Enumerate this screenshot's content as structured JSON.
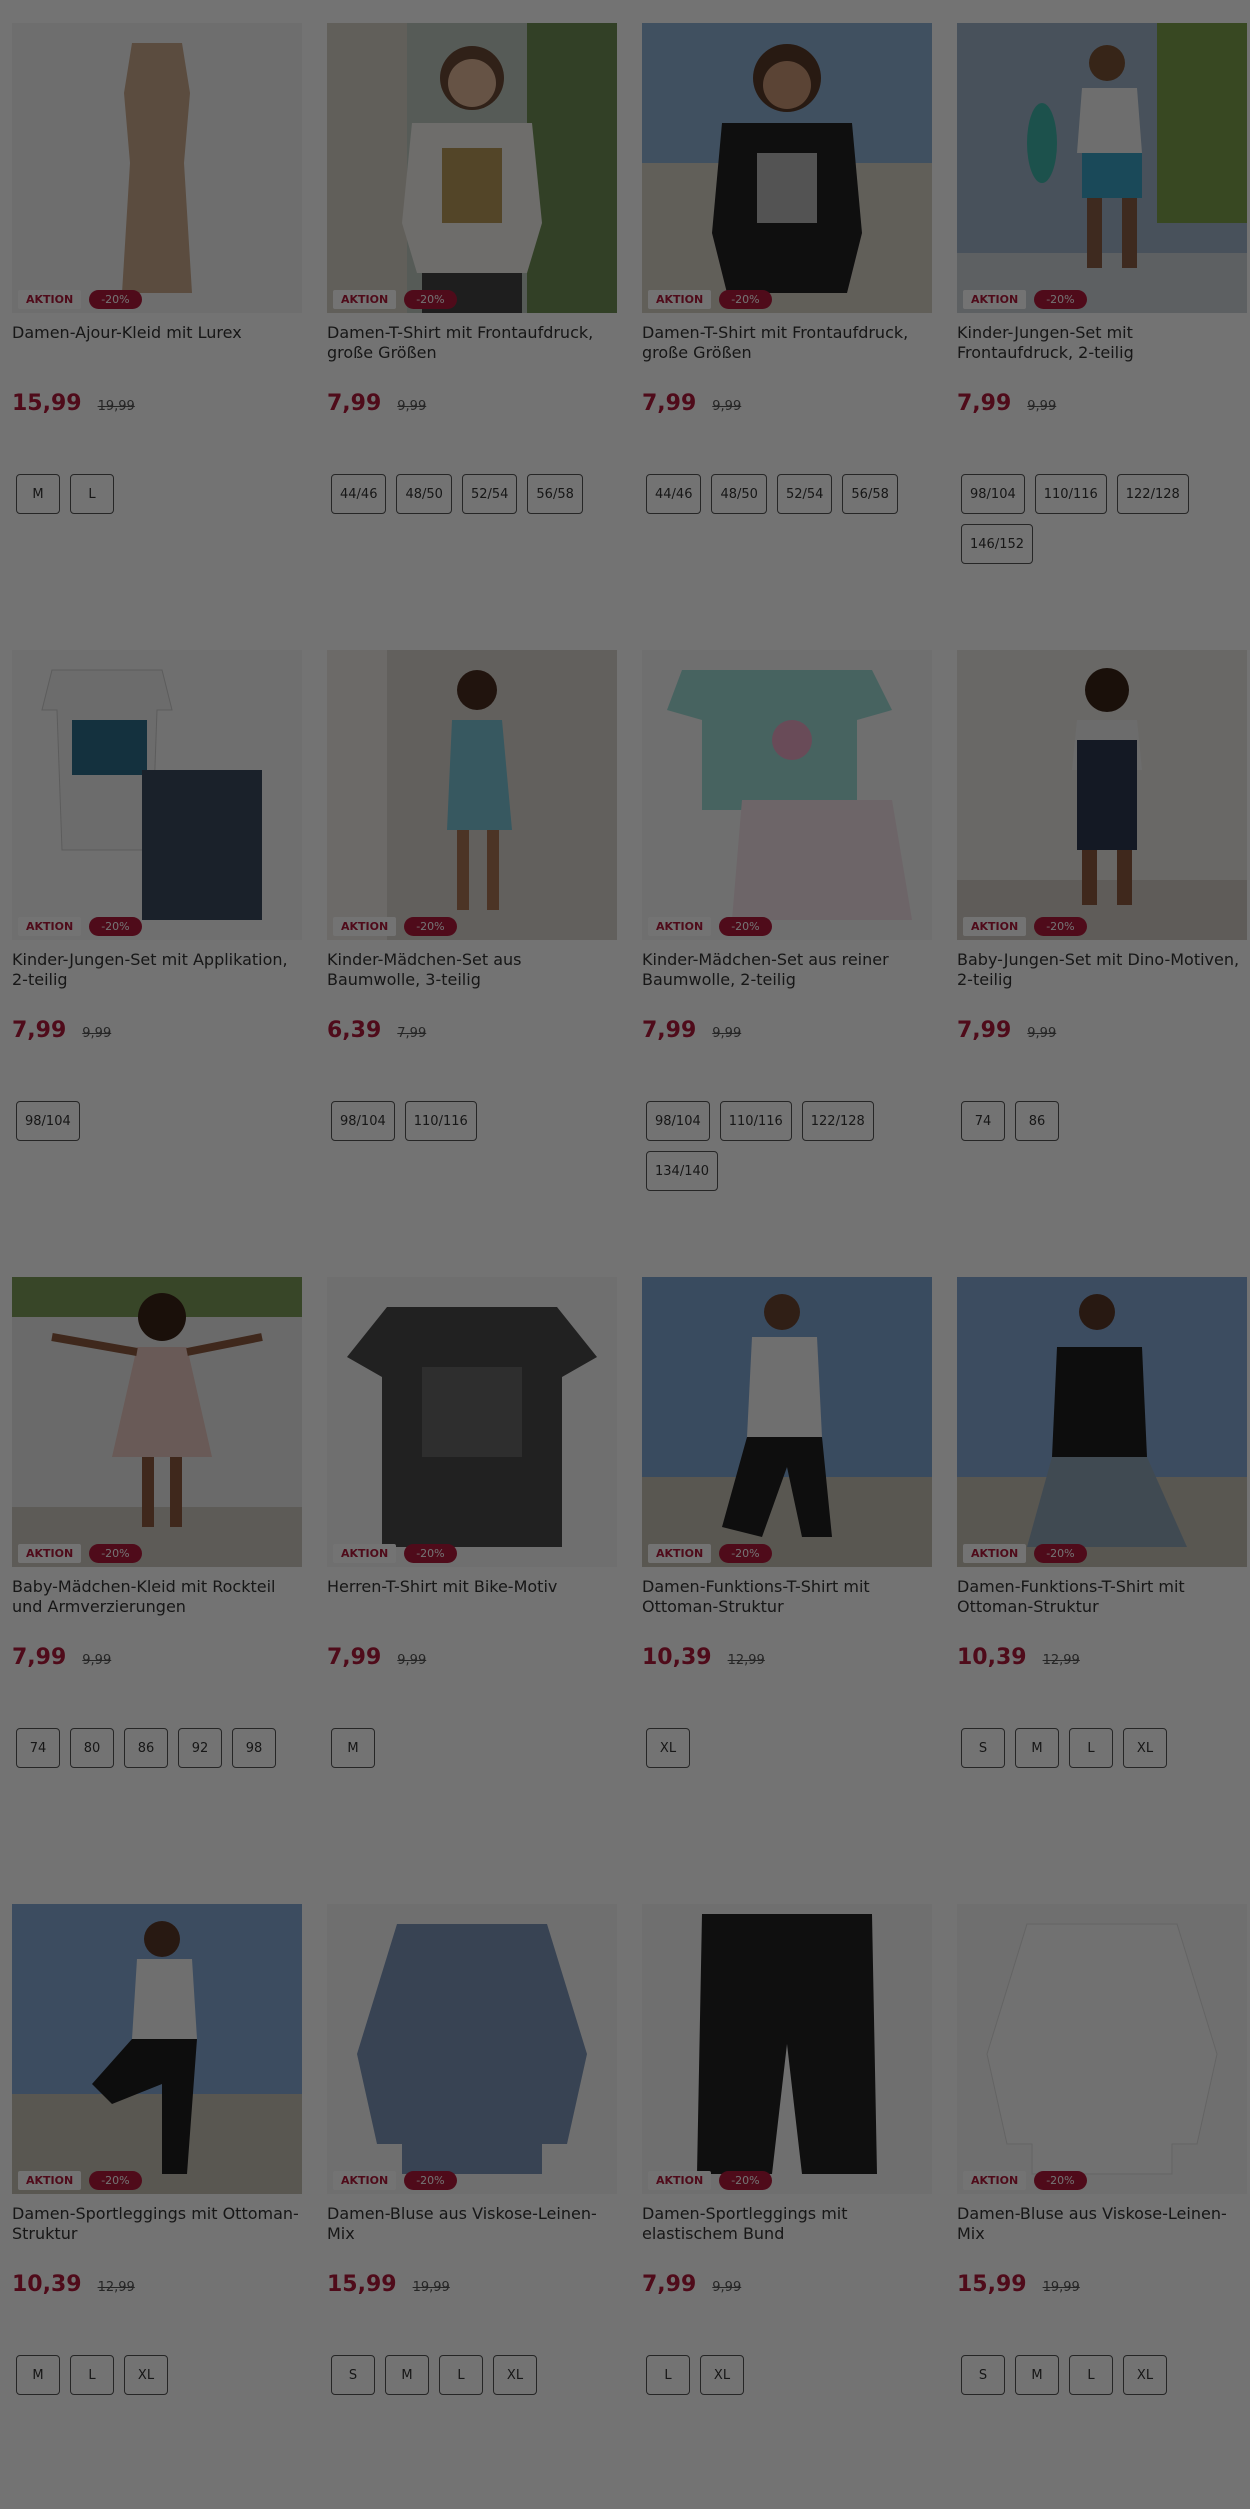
{
  "badge_label": "AKTION",
  "colors": {
    "accent": "#b0193a",
    "overlay": "rgba(0,0,0,0.55)"
  },
  "products": [
    {
      "title": "Damen-Ajour-Kleid mit Lurex",
      "discount": "-20%",
      "price": "15,99",
      "old_price": "19,99",
      "sizes": [
        "M",
        "L"
      ],
      "image": "dress-beige"
    },
    {
      "title": "Damen-T-Shirt mit Frontaufdruck, große Größen",
      "discount": "-20%",
      "price": "7,99",
      "old_price": "9,99",
      "sizes": [
        "44/46",
        "48/50",
        "52/54",
        "56/58"
      ],
      "image": "woman-white-tshirt"
    },
    {
      "title": "Damen-T-Shirt mit Frontaufdruck, große Größen",
      "discount": "-20%",
      "price": "7,99",
      "old_price": "9,99",
      "sizes": [
        "44/46",
        "48/50",
        "52/54",
        "56/58"
      ],
      "image": "woman-black-tshirt"
    },
    {
      "title": "Kinder-Jungen-Set mit Frontaufdruck, 2-teilig",
      "discount": "-20%",
      "price": "7,99",
      "old_price": "9,99",
      "sizes": [
        "98/104",
        "110/116",
        "122/128",
        "146/152"
      ],
      "image": "boy-skateboard"
    },
    {
      "title": "Kinder-Jungen-Set mit Applikation, 2-teilig",
      "discount": "-20%",
      "price": "7,99",
      "old_price": "9,99",
      "sizes": [
        "98/104"
      ],
      "image": "boy-set-shorts"
    },
    {
      "title": "Kinder-Mädchen-Set aus Baumwolle, 3-teilig",
      "discount": "-20%",
      "price": "6,39",
      "old_price": "7,99",
      "sizes": [
        "98/104",
        "110/116"
      ],
      "image": "girl-overall"
    },
    {
      "title": "Kinder-Mädchen-Set aus reiner Baumwolle, 2-teilig",
      "discount": "-20%",
      "price": "7,99",
      "old_price": "9,99",
      "sizes": [
        "98/104",
        "110/116",
        "122/128",
        "134/140"
      ],
      "image": "girl-set-mint"
    },
    {
      "title": "Baby-Jungen-Set mit Dino-Motiven, 2-teilig",
      "discount": "-20%",
      "price": "7,99",
      "old_price": "9,99",
      "sizes": [
        "74",
        "86"
      ],
      "image": "baby-dungaree"
    },
    {
      "title": "Baby-Mädchen-Kleid mit Rockteil und Armverzierungen",
      "discount": "-20%",
      "price": "7,99",
      "old_price": "9,99",
      "sizes": [
        "74",
        "80",
        "86",
        "92",
        "98"
      ],
      "image": "baby-girl-dress"
    },
    {
      "title": "Herren-T-Shirt mit Bike-Motiv",
      "discount": "-20%",
      "price": "7,99",
      "old_price": "9,99",
      "sizes": [
        "M"
      ],
      "image": "men-tshirt-bike"
    },
    {
      "title": "Damen-Funktions-T-Shirt mit Ottoman-Struktur",
      "discount": "-20%",
      "price": "10,39",
      "old_price": "12,99",
      "sizes": [
        "XL"
      ],
      "image": "sport-white"
    },
    {
      "title": "Damen-Funktions-T-Shirt mit Ottoman-Struktur",
      "discount": "-20%",
      "price": "10,39",
      "old_price": "12,99",
      "sizes": [
        "S",
        "M",
        "L",
        "XL"
      ],
      "image": "sport-black"
    },
    {
      "title": "Damen-Sportleggings mit Ottoman-Struktur",
      "discount": "-20%",
      "price": "10,39",
      "old_price": "12,99",
      "sizes": [
        "M",
        "L",
        "XL"
      ],
      "image": "sport-leggings-pose"
    },
    {
      "title": "Damen-Bluse aus Viskose-Leinen-Mix",
      "discount": "-20%",
      "price": "15,99",
      "old_price": "19,99",
      "sizes": [
        "S",
        "M",
        "L",
        "XL"
      ],
      "image": "blouse-blue"
    },
    {
      "title": "Damen-Sportleggings mit elastischem Bund",
      "discount": "-20%",
      "price": "7,99",
      "old_price": "9,99",
      "sizes": [
        "L",
        "XL"
      ],
      "image": "cycling-shorts"
    },
    {
      "title": "Damen-Bluse aus Viskose-Leinen-Mix",
      "discount": "-20%",
      "price": "15,99",
      "old_price": "19,99",
      "sizes": [
        "S",
        "M",
        "L",
        "XL"
      ],
      "image": "blouse-white"
    }
  ]
}
